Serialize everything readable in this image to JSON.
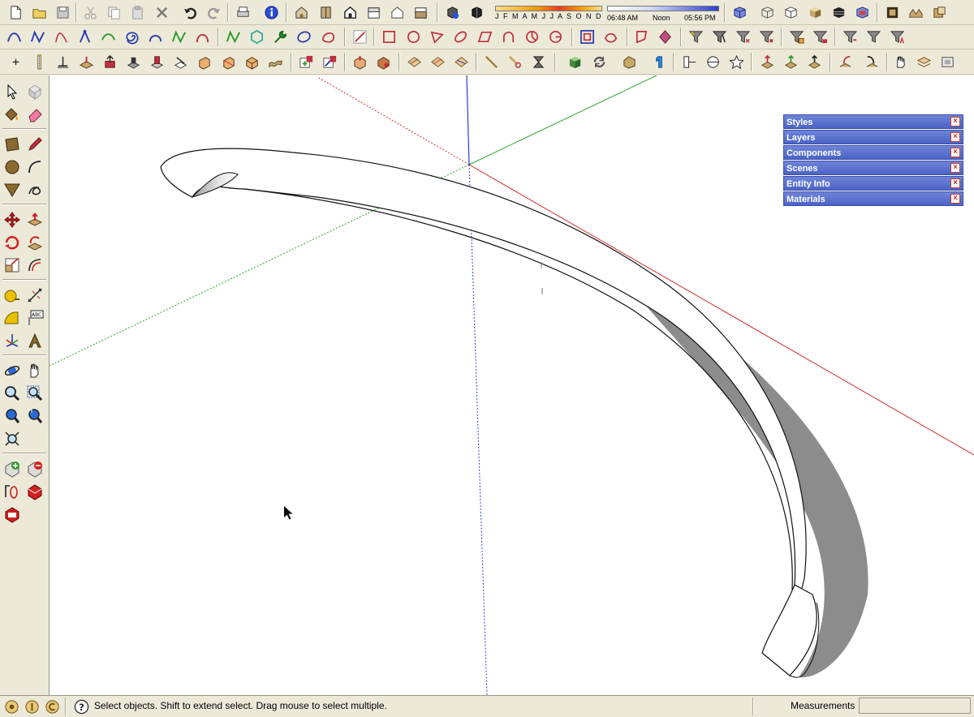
{
  "shadow_settings": {
    "months": "J F M A M J J A S O N D",
    "time_start": "06:48 AM",
    "time_noon": "Noon",
    "time_end": "05:56 PM"
  },
  "trays": [
    {
      "label": "Styles"
    },
    {
      "label": "Layers"
    },
    {
      "label": "Components"
    },
    {
      "label": "Scenes"
    },
    {
      "label": "Entity Info"
    },
    {
      "label": "Materials"
    }
  ],
  "tray_close_glyph": "×",
  "status": {
    "prompt": "Select objects. Shift to extend select. Drag mouse to select multiple.",
    "measurements_label": "Measurements",
    "measurements_value": ""
  },
  "colors": {
    "axis_red": "#d42a2a",
    "axis_green": "#2aa52a",
    "axis_blue": "#2a3fd4",
    "tray_blue": "#5a72d0",
    "shadow_gray": "#8c8c8c"
  },
  "icons": {
    "row1": [
      "new-file-icon",
      "open-folder-icon",
      "save-icon",
      "cut-icon",
      "copy-icon",
      "paste-icon",
      "delete-icon",
      "undo-icon",
      "redo-icon",
      "print-icon",
      "model-info-icon",
      "iso-view-icon",
      "top-view-icon",
      "front-view-icon",
      "right-view-icon",
      "back-view-icon",
      "left-view-icon",
      "shadow-settings-icon",
      "display-shadows-icon",
      "xray-icon",
      "wireframe-icon",
      "hidden-line-icon",
      "shaded-icon",
      "shaded-textures-icon",
      "monochrome-icon",
      "photo-texture-icon",
      "sandbox-icon",
      "component-browse-icon"
    ],
    "row2": [
      "bezier-icon",
      "freehand-icon",
      "polyline-icon",
      "spline-icon",
      "arc-icon",
      "spiral-icon",
      "arc2-icon",
      "curve-icon",
      "curve2-icon",
      "catenary-icon",
      "polygon-icon",
      "wrench-icon",
      "ellipse-icon",
      "shape-icon",
      "line-icon",
      "rectangle-icon",
      "circle-icon",
      "triangle-icon",
      "oval-icon",
      "parallelogram-icon",
      "arc-tool-icon",
      "pie-icon",
      "segment-icon",
      "offset-icon",
      "curve-edit-icon",
      "polygon2-icon",
      "gem-icon",
      "filter-icon",
      "filter2-icon",
      "filter3-icon",
      "filter4-icon",
      "filter5-icon",
      "filter6-icon",
      "filter7-icon",
      "filter8-icon"
    ],
    "row3": [
      "axis-icon",
      "guide-icon",
      "dimension-icon",
      "section-icon",
      "push-icon",
      "follow-icon",
      "intersect-icon",
      "fold-icon",
      "extrude-icon",
      "loft-icon",
      "sandbox-grid-icon",
      "smoove-icon",
      "stamp-icon",
      "drape-icon",
      "add-detail-icon",
      "flip-edge-icon",
      "skin-icon",
      "stretch-icon",
      "twist-icon",
      "box-icon",
      "rotate-icon",
      "bend-icon",
      "number-1-icon",
      "section-plane-icon",
      "section-cut-icon",
      "star-icon",
      "label-j-icon",
      "label-av-icon",
      "label-n-icon",
      "arrow-up-icon",
      "arrow-up2-icon",
      "hand-icon",
      "layers-stack-icon",
      "camera-icon"
    ]
  }
}
